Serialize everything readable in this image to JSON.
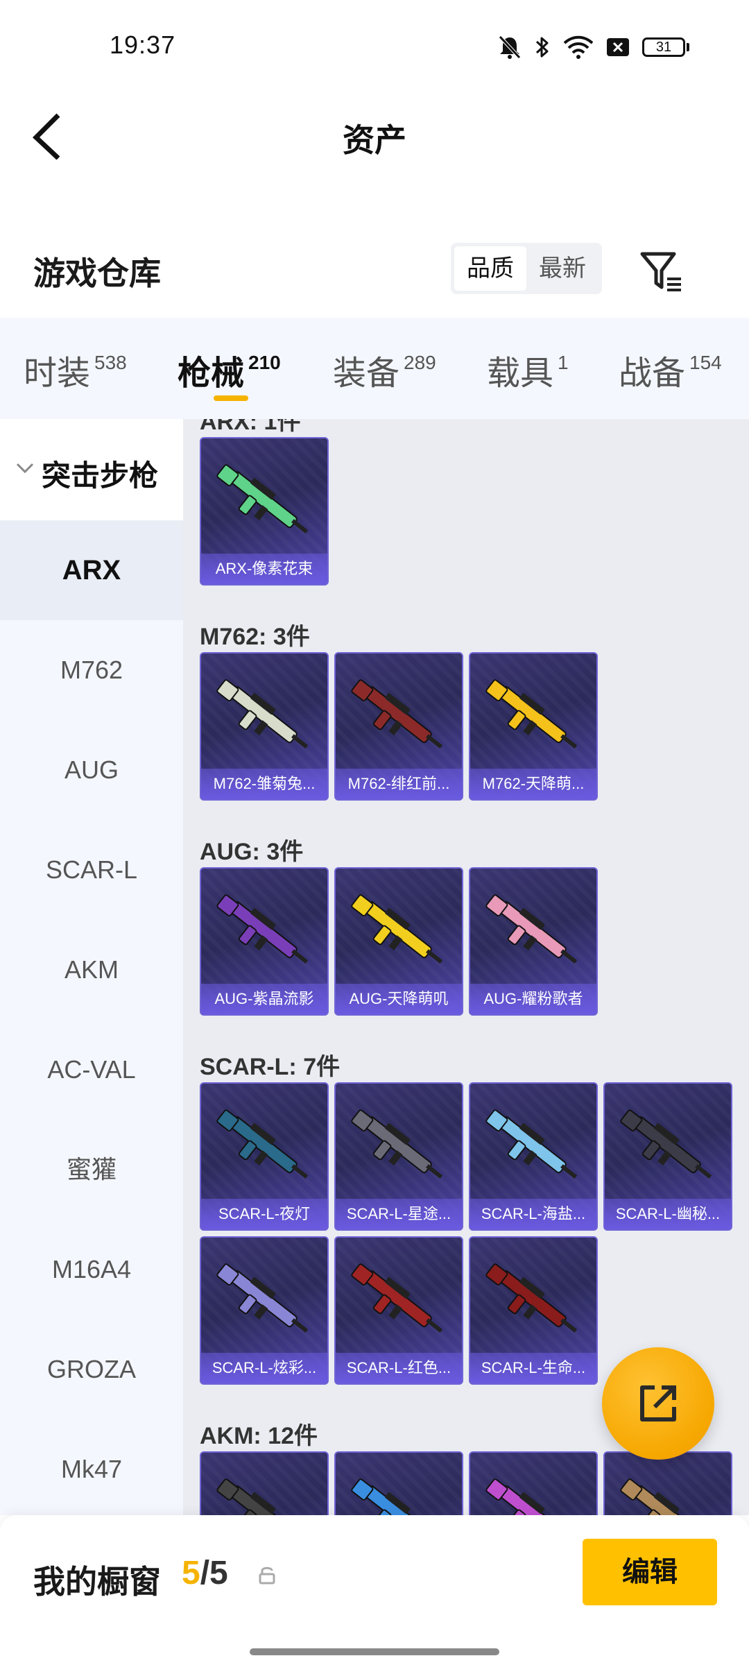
{
  "status_bar": {
    "time": "19:37",
    "battery": "31"
  },
  "header": {
    "title": "资产"
  },
  "warehouse": {
    "title": "游戏仓库",
    "sort_options": [
      "品质",
      "最新"
    ],
    "sort_active": "品质"
  },
  "tabs": [
    {
      "label": "时装",
      "count": "538"
    },
    {
      "label": "枪械",
      "count": "210",
      "active": true
    },
    {
      "label": "装备",
      "count": "289"
    },
    {
      "label": "载具",
      "count": "1"
    },
    {
      "label": "战备",
      "count": "154"
    }
  ],
  "sidebar": {
    "group": "突击步枪",
    "items": [
      "ARX",
      "M762",
      "AUG",
      "SCAR-L",
      "AKM",
      "AC-VAL",
      "蜜獾",
      "M16A4",
      "GROZA",
      "Mk47"
    ],
    "active": "ARX"
  },
  "sections": [
    {
      "title": "ARX: 1件",
      "items": [
        {
          "label": "ARX-像素花束",
          "color": "#5fd38a"
        }
      ]
    },
    {
      "title": "M762: 3件",
      "items": [
        {
          "label": "M762-雏菊兔...",
          "color": "#d8dccb"
        },
        {
          "label": "M762-绯红前...",
          "color": "#8c2a2a"
        },
        {
          "label": "M762-天降萌...",
          "color": "#f4c21b"
        }
      ]
    },
    {
      "title": "AUG: 3件",
      "items": [
        {
          "label": "AUG-紫晶流影",
          "color": "#7a3fb8"
        },
        {
          "label": "AUG-天降萌叽",
          "color": "#f2cf1e"
        },
        {
          "label": "AUG-耀粉歌者",
          "color": "#e89ab8"
        }
      ]
    },
    {
      "title": "SCAR-L: 7件",
      "items": [
        {
          "label": "SCAR-L-夜灯",
          "color": "#2a6a8a"
        },
        {
          "label": "SCAR-L-星途...",
          "color": "#6b6b78"
        },
        {
          "label": "SCAR-L-海盐...",
          "color": "#7fc4ea"
        },
        {
          "label": "SCAR-L-幽秘...",
          "color": "#3c3c48"
        },
        {
          "label": "SCAR-L-炫彩...",
          "color": "#8a86d6"
        },
        {
          "label": "SCAR-L-红色...",
          "color": "#a02424"
        },
        {
          "label": "SCAR-L-生命...",
          "color": "#8a1c1c"
        }
      ]
    },
    {
      "title": "AKM: 12件",
      "items": [
        {
          "label": "",
          "color": "#444"
        },
        {
          "label": "",
          "color": "#3a8ee0"
        },
        {
          "label": "",
          "color": "#c04fd0"
        },
        {
          "label": "",
          "color": "#b08a5a"
        }
      ]
    }
  ],
  "showcase": {
    "title": "我的橱窗",
    "current": "5",
    "total": "/5",
    "edit_label": "编辑"
  },
  "icons": {
    "back": "chevron-left-icon",
    "filter": "filter-icon",
    "share": "share-external-icon",
    "lock": "lock-icon"
  }
}
